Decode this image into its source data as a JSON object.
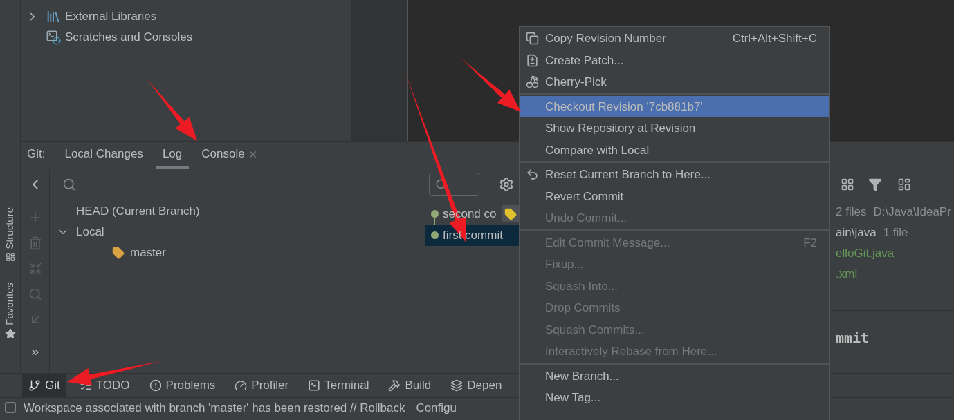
{
  "left_stripe": [
    {
      "label": "Structure",
      "kind": "structure"
    },
    {
      "label": "Favorites",
      "kind": "favorites"
    }
  ],
  "project_tree": [
    {
      "label": "External Libraries",
      "kind": "libraries",
      "expanded": false
    },
    {
      "label": "Scratches and Consoles",
      "kind": "scratches"
    }
  ],
  "tool_window": {
    "title": "Git:",
    "tabs": [
      {
        "label": "Local Changes",
        "selected": false,
        "closable": false
      },
      {
        "label": "Log",
        "selected": true,
        "closable": false
      },
      {
        "label": "Console",
        "selected": false,
        "closable": true
      }
    ]
  },
  "branches": [
    {
      "label": "HEAD (Current Branch)"
    },
    {
      "label": "Local",
      "expanded": true,
      "children": [
        {
          "label": "master"
        }
      ]
    }
  ],
  "commits": [
    {
      "message": "second co",
      "selected": false,
      "tagged": true
    },
    {
      "message": "first commit",
      "selected": true,
      "tagged": false
    }
  ],
  "details": {
    "lines": [
      {
        "count": "2 files",
        "path": "D:\\Java\\IdeaPr"
      },
      {
        "name": "ain\\java",
        "count": "1 file"
      },
      {
        "name": "elloGit.java",
        "color": "#629755"
      },
      {
        "name": ".xml",
        "color": "#629755"
      }
    ],
    "commit_title": "mmit"
  },
  "bottom_tools": [
    {
      "label": "Git",
      "kind": "git",
      "selected": true
    },
    {
      "label": "TODO",
      "kind": "todo",
      "selected": false
    },
    {
      "label": "Problems",
      "kind": "problems",
      "selected": false
    },
    {
      "label": "Profiler",
      "kind": "profiler",
      "selected": false
    },
    {
      "label": "Terminal",
      "kind": "terminal",
      "selected": false
    },
    {
      "label": "Build",
      "kind": "build",
      "selected": false
    },
    {
      "label": "Depen",
      "kind": "dependencies",
      "selected": false
    }
  ],
  "status": {
    "message": "Workspace associated with branch 'master' has been restored // Rollback",
    "extra": "Configu"
  },
  "context_menu": [
    [
      {
        "label": "Copy Revision Number",
        "shortcut": "Ctrl+Alt+Shift+C",
        "kind": "copy",
        "disabled": false,
        "selected": false
      },
      {
        "label": "Create Patch...",
        "kind": "patch",
        "disabled": false,
        "selected": false
      },
      {
        "label": "Cherry-Pick",
        "kind": "cherry",
        "disabled": false,
        "selected": false
      }
    ],
    [
      {
        "label": "Checkout Revision '7cb881b7'",
        "disabled": false,
        "selected": true
      },
      {
        "label": "Show Repository at Revision",
        "disabled": false,
        "selected": false
      },
      {
        "label": "Compare with Local",
        "disabled": false,
        "selected": false
      }
    ],
    [
      {
        "label": "Reset Current Branch to Here...",
        "kind": "undo",
        "disabled": false,
        "selected": false
      },
      {
        "label": "Revert Commit",
        "disabled": false,
        "selected": false
      },
      {
        "label": "Undo Commit...",
        "disabled": true,
        "selected": false
      }
    ],
    [
      {
        "label": "Edit Commit Message...",
        "shortcut": "F2",
        "disabled": true,
        "selected": false
      },
      {
        "label": "Fixup...",
        "disabled": true,
        "selected": false
      },
      {
        "label": "Squash Into...",
        "disabled": true,
        "selected": false
      },
      {
        "label": "Drop Commits",
        "disabled": true,
        "selected": false
      },
      {
        "label": "Squash Commits...",
        "disabled": true,
        "selected": false
      },
      {
        "label": "Interactively Rebase from Here...",
        "disabled": true,
        "selected": false
      }
    ],
    [
      {
        "label": "New Branch...",
        "disabled": false,
        "selected": false
      },
      {
        "label": "New Tag...",
        "disabled": false,
        "selected": false
      }
    ]
  ]
}
